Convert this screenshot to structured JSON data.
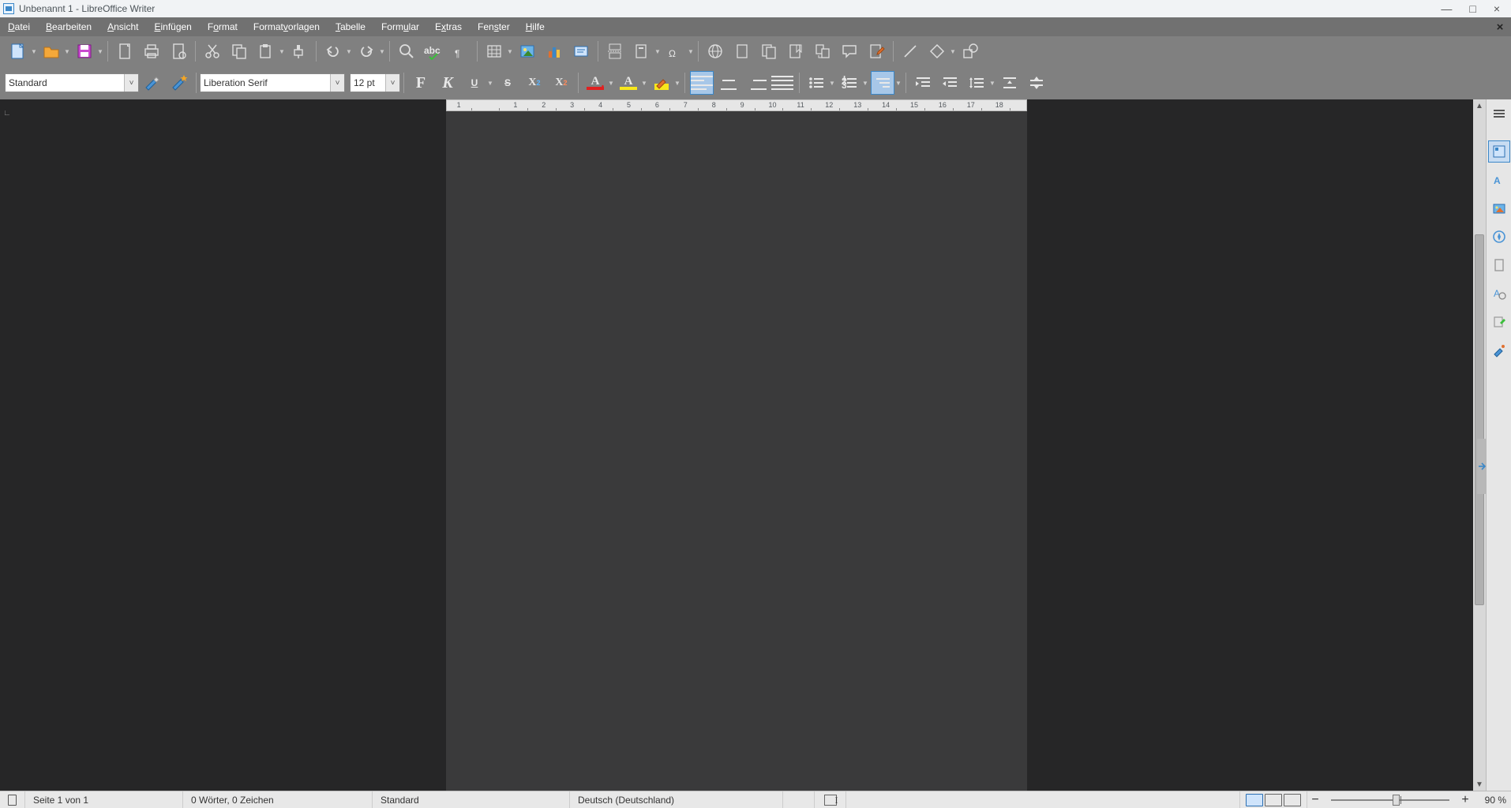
{
  "title": "Unbenannt 1 - LibreOffice Writer",
  "menu": [
    "Datei",
    "Bearbeiten",
    "Ansicht",
    "Einfügen",
    "Format",
    "Formatvorlagen",
    "Tabelle",
    "Formular",
    "Extras",
    "Fenster",
    "Hilfe"
  ],
  "format_toolbar": {
    "paragraph_style": "Standard",
    "font_name": "Liberation Serif",
    "font_size": "12 pt"
  },
  "ruler_numbers": [
    "1",
    "",
    "1",
    "2",
    "3",
    "4",
    "5",
    "6",
    "7",
    "8",
    "9",
    "10",
    "11",
    "12",
    "13",
    "14",
    "15",
    "16",
    "17",
    "18"
  ],
  "status": {
    "page": "Seite 1 von 1",
    "words": "0 Wörter, 0 Zeichen",
    "style": "Standard",
    "language": "Deutsch (Deutschland)",
    "zoom": "90 %"
  },
  "sidebar_icons": [
    "menu",
    "properties",
    "styles",
    "gallery",
    "navigator",
    "page",
    "style-inspector",
    "changes",
    "accessibility",
    "find"
  ]
}
